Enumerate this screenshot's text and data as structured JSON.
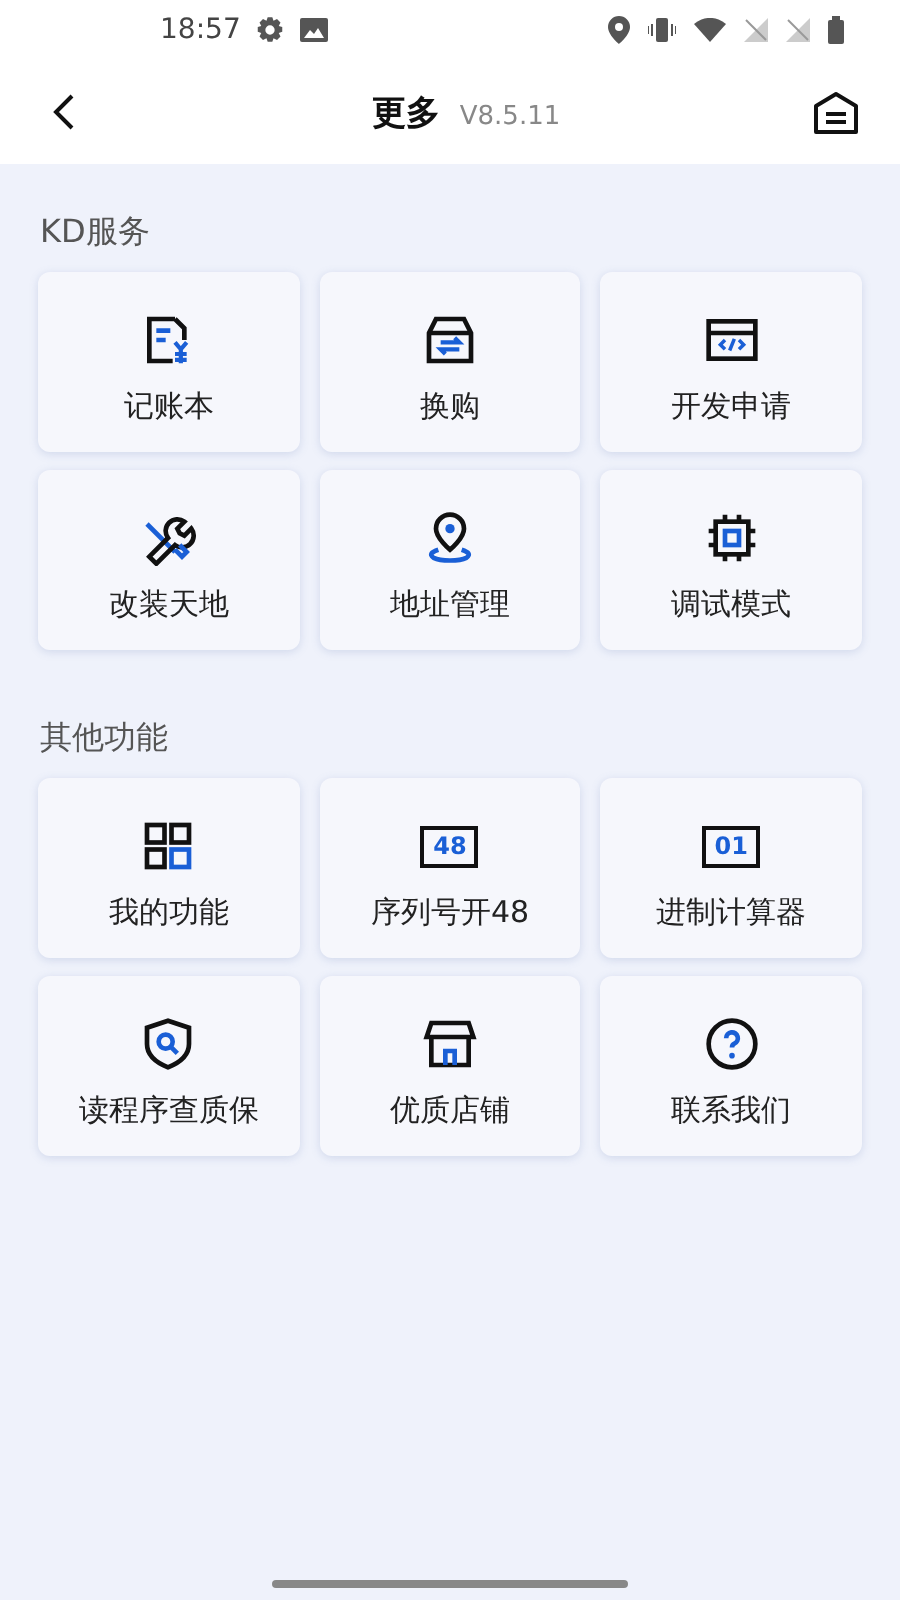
{
  "status_bar": {
    "time": "18:57"
  },
  "header": {
    "title": "更多",
    "version": "V8.5.11"
  },
  "sections": [
    {
      "title": "KD服务",
      "items": [
        {
          "label": "记账本",
          "kind": "ledger"
        },
        {
          "label": "换购",
          "kind": "exchange"
        },
        {
          "label": "开发申请",
          "kind": "code"
        },
        {
          "label": "改装天地",
          "kind": "tools"
        },
        {
          "label": "地址管理",
          "kind": "location"
        },
        {
          "label": "调试模式",
          "kind": "chip"
        }
      ]
    },
    {
      "title": "其他功能",
      "items": [
        {
          "label": "我的功能",
          "kind": "grid"
        },
        {
          "label": "序列号开48",
          "kind": "screen",
          "icon_text": "48"
        },
        {
          "label": "进制计算器",
          "kind": "screen",
          "icon_text": "01"
        },
        {
          "label": "读程序查质保",
          "kind": "shield"
        },
        {
          "label": "优质店铺",
          "kind": "store"
        },
        {
          "label": "联系我们",
          "kind": "help"
        }
      ]
    }
  ]
}
